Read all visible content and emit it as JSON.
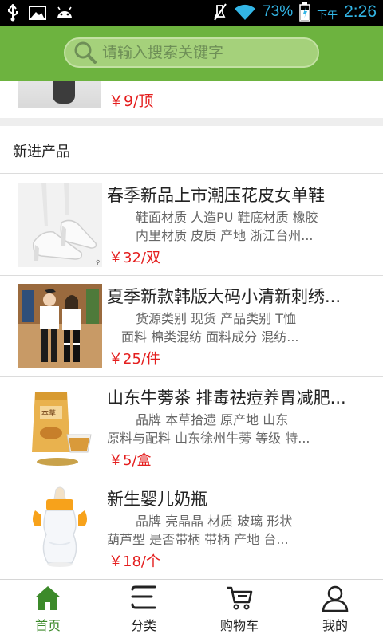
{
  "status_bar": {
    "battery_percent": "73%",
    "ampm": "下午",
    "time": "2:26"
  },
  "search": {
    "placeholder": "请输入搜索关键字"
  },
  "partial_item": {
    "price": "￥9/顶"
  },
  "section": {
    "title": "新进产品"
  },
  "products": [
    {
      "name": "春季新品上市潮压花皮女单鞋",
      "attr_line1": "鞋面材质 人造PU        鞋底材质 橡胶",
      "attr_line2": "内里材质 皮质        产地 浙江台州...",
      "price": "￥32/双"
    },
    {
      "name": "夏季新款韩版大码小清新刺绣...",
      "attr_line1": "货源类别 现货        产品类别 T恤",
      "attr_line2": "面料 棉类混纺        面料成分 混纺...",
      "price": "￥25/件"
    },
    {
      "name": "山东牛蒡茶 排毒祛痘养胃减肥...",
      "attr_line1": "品牌 本草拾遗        原产地 山东",
      "attr_line2": "原料与配料 山东徐州牛蒡        等级 特...",
      "price": "￥5/盒"
    },
    {
      "name": "新生婴儿奶瓶",
      "attr_line1": "品牌 亮晶晶        材质 玻璃        形状",
      "attr_line2": "葫芦型        是否带柄 带柄        产地 台...",
      "price": "￥18/个"
    }
  ],
  "bottom_nav": [
    {
      "label": "首页",
      "icon": "home-icon",
      "active": true
    },
    {
      "label": "分类",
      "icon": "category-icon",
      "active": false
    },
    {
      "label": "购物车",
      "icon": "cart-icon",
      "active": false
    },
    {
      "label": "我的",
      "icon": "user-icon",
      "active": false
    }
  ],
  "colors": {
    "header_green": "#6db33f",
    "price_red": "#e41e1e",
    "active_nav": "#3c8a2a",
    "status_blue": "#33b5e5"
  }
}
